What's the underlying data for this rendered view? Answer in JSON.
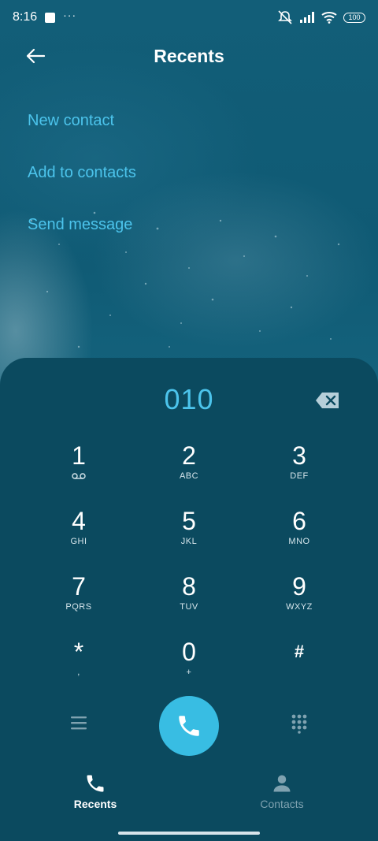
{
  "status_bar": {
    "time": "8:16",
    "more": "···",
    "battery": "100"
  },
  "header": {
    "title": "Recents"
  },
  "actions": [
    "New contact",
    "Add to contacts",
    "Send message"
  ],
  "dialer": {
    "number": "010",
    "keys": [
      {
        "digit": "1",
        "letters": ""
      },
      {
        "digit": "2",
        "letters": "ABC"
      },
      {
        "digit": "3",
        "letters": "DEF"
      },
      {
        "digit": "4",
        "letters": "GHI"
      },
      {
        "digit": "5",
        "letters": "JKL"
      },
      {
        "digit": "6",
        "letters": "MNO"
      },
      {
        "digit": "7",
        "letters": "PQRS"
      },
      {
        "digit": "8",
        "letters": "TUV"
      },
      {
        "digit": "9",
        "letters": "WXYZ"
      },
      {
        "digit": "*",
        "letters": ","
      },
      {
        "digit": "0",
        "letters": "+"
      },
      {
        "digit": "#",
        "letters": ""
      }
    ]
  },
  "tabs": [
    {
      "label": "Recents",
      "icon": "phone-icon",
      "active": true
    },
    {
      "label": "Contacts",
      "icon": "person-icon",
      "active": false
    }
  ],
  "colors": {
    "accent": "#38bde3",
    "link": "#4cc4ec",
    "panel": "#0b4a5f"
  }
}
